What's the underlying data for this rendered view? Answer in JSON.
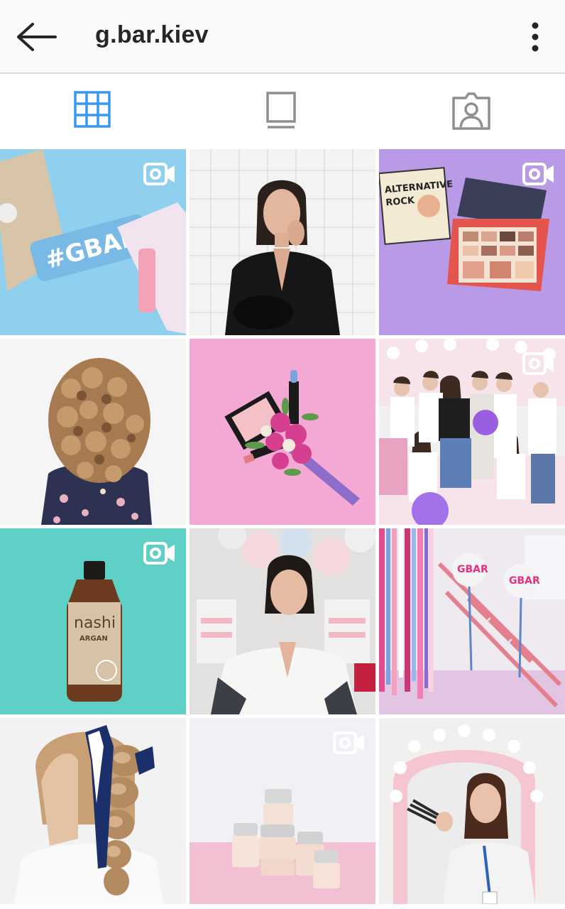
{
  "header": {
    "title": "g.bar.kiev",
    "back_icon": "arrow-left-icon",
    "more_icon": "more-vertical-icon"
  },
  "tabs": [
    {
      "name": "grid",
      "icon": "grid-icon",
      "active": true
    },
    {
      "name": "feed",
      "icon": "feed-icon",
      "active": false
    },
    {
      "name": "tagged",
      "icon": "tagged-person-icon",
      "active": false
    }
  ],
  "colors": {
    "accent": "#3897f0",
    "inactive_icon": "#8e8e8e",
    "header_bg": "#fafafa"
  },
  "posts": [
    {
      "row": 1,
      "col": 1,
      "subject": "blue background beauty patches",
      "video": true,
      "text": "#GBAR"
    },
    {
      "row": 1,
      "col": 2,
      "subject": "woman in black jacket",
      "video": false
    },
    {
      "row": 1,
      "col": 3,
      "subject": "eyeshadow palette on purple",
      "video": true,
      "text": "ALTERNATIVE ROCK"
    },
    {
      "row": 2,
      "col": 1,
      "subject": "curly hair back view",
      "video": false
    },
    {
      "row": 2,
      "col": 2,
      "subject": "makeup flatlay on pink",
      "video": false
    },
    {
      "row": 2,
      "col": 3,
      "subject": "team group photo",
      "video": true
    },
    {
      "row": 3,
      "col": 1,
      "subject": "nashi argan shampoo bottle",
      "video": true,
      "text": "nashi ARGAN"
    },
    {
      "row": 3,
      "col": 2,
      "subject": "woman in salon",
      "video": false
    },
    {
      "row": 3,
      "col": 3,
      "subject": "pink staircase with balloons",
      "video": false,
      "text": "GBAR"
    },
    {
      "row": 4,
      "col": 1,
      "subject": "braided hairstyle with scarf",
      "video": false
    },
    {
      "row": 4,
      "col": 2,
      "subject": "cream jars on pink",
      "video": true
    },
    {
      "row": 4,
      "col": 3,
      "subject": "woman with makeup brushes at mirror",
      "video": false
    }
  ]
}
